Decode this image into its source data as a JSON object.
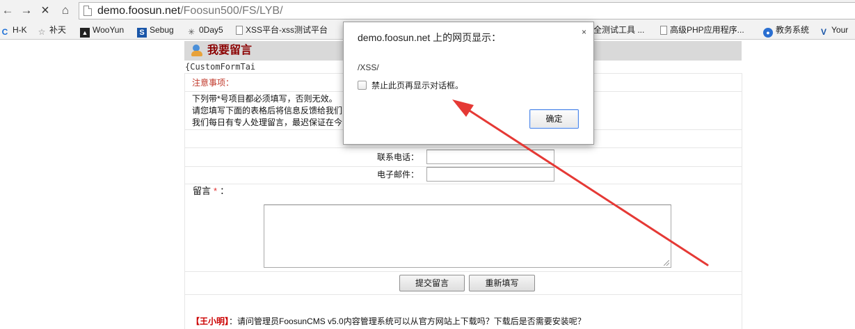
{
  "browser": {
    "url_host": "demo.foosun.net",
    "url_path": "/Foosun500/FS/LYB/",
    "bookmarks": [
      {
        "label": "H-K",
        "icon": "c-logo-icon"
      },
      {
        "label": "补天",
        "icon": "star-icon"
      },
      {
        "label": "WooYun",
        "icon": "wooyun-icon"
      },
      {
        "label": "Sebug",
        "icon": "s-logo-icon"
      },
      {
        "label": "0Day5",
        "icon": "spark-icon"
      },
      {
        "label": "XSS平台-xss测试平台",
        "icon": "page-icon"
      },
      {
        "label": "全测试工具 ...",
        "icon": "page-icon"
      },
      {
        "label": "高级PHP应用程序...",
        "icon": "page-icon"
      },
      {
        "label": "教务系统",
        "icon": "globe-icon"
      },
      {
        "label": "Your",
        "icon": "v-logo-icon"
      }
    ]
  },
  "page": {
    "title": "我要留言",
    "template_tag": "{CustomFormTai",
    "notice_heading": "注意事项：",
    "notice_lines": [
      "下列带*号项目都必须填写，否则无效。",
      "请您填写下面的表格后将信息反馈给我们",
      "我们每日有专人处理留言，最迟保证在今"
    ],
    "fields": {
      "phone_label": "联系电话：",
      "email_label": "电子邮件：",
      "message_label": "留言",
      "required_mark": "*",
      "message_colon": "："
    },
    "buttons": {
      "submit": "提交留言",
      "reset": "重新填写"
    },
    "comment": {
      "name": "【王小明】",
      "text": "：请问管理员FoosunCMS v5.0内容管理系统可以从官方网站上下载吗？下载后是否需要安装呢？"
    }
  },
  "dialog": {
    "title": "demo.foosun.net 上的网页显示：",
    "close": "×",
    "message": "/XSS/",
    "checkbox_label": "禁止此页再显示对话框。",
    "ok": "确定"
  },
  "colors": {
    "title_text": "#8b0000",
    "notice_heading": "#c0392b",
    "arrow": "#e53935",
    "comment_name": "#cc0000"
  }
}
